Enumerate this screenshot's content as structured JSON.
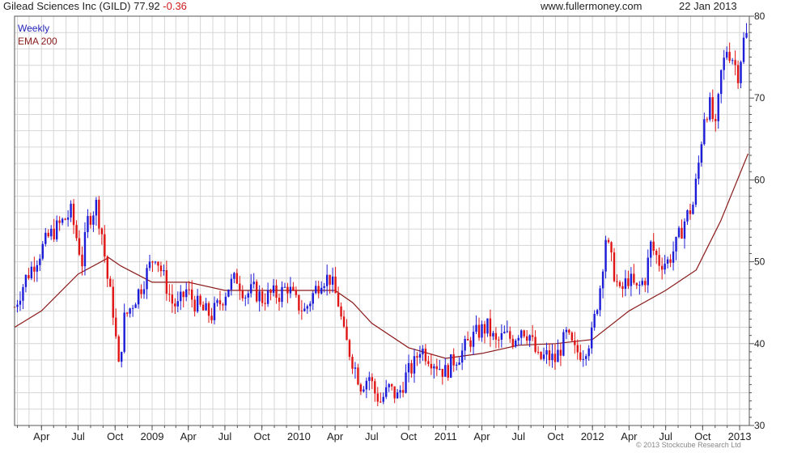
{
  "header": {
    "title": "Gilead Sciences Inc (GILD) 77.92",
    "change": "-0.36",
    "source": "www.fullermoney.com",
    "date": "22 Jan 2013"
  },
  "legend": {
    "weekly": "Weekly",
    "ema": "EMA 200"
  },
  "copyright": "© 2013 Stockcube Research Ltd",
  "colors": {
    "up": "#1c1cd9",
    "down": "#e01414",
    "ema": "#8b1a1a",
    "grid": "#d6d6d6"
  },
  "chart_data": {
    "type": "candlestick",
    "interval": "weekly",
    "y_ticks": [
      30,
      40,
      50,
      60,
      70,
      80
    ],
    "ylim": [
      30,
      80
    ],
    "x_ticks": [
      "Apr",
      "Jul",
      "Oct",
      "2009",
      "Apr",
      "Jul",
      "Oct",
      "2010",
      "Apr",
      "Jul",
      "Oct",
      "2011",
      "Apr",
      "Jul",
      "Oct",
      "2012",
      "Apr",
      "Jul",
      "Oct",
      "2013"
    ],
    "x_tick_dates": [
      "2008-04-01",
      "2008-07-01",
      "2008-10-01",
      "2009-01-01",
      "2009-04-01",
      "2009-07-01",
      "2009-10-01",
      "2010-01-01",
      "2010-04-01",
      "2010-07-01",
      "2010-10-01",
      "2011-01-01",
      "2011-04-01",
      "2011-07-01",
      "2011-10-01",
      "2012-01-01",
      "2012-04-01",
      "2012-07-01",
      "2012-10-01",
      "2013-01-01"
    ],
    "price_path": [
      [
        "2008-01-25",
        44.5
      ],
      [
        "2008-02-22",
        48
      ],
      [
        "2008-03-21",
        50.5
      ],
      [
        "2008-04-18",
        53
      ],
      [
        "2008-05-16",
        54.5
      ],
      [
        "2008-06-13",
        56
      ],
      [
        "2008-06-27",
        53
      ],
      [
        "2008-07-11",
        50
      ],
      [
        "2008-07-25",
        55
      ],
      [
        "2008-08-15",
        57
      ],
      [
        "2008-08-29",
        53.5
      ],
      [
        "2008-09-12",
        48
      ],
      [
        "2008-09-26",
        44
      ],
      [
        "2008-10-10",
        37
      ],
      [
        "2008-10-24",
        43
      ],
      [
        "2008-11-14",
        45
      ],
      [
        "2008-12-05",
        47
      ],
      [
        "2008-12-26",
        49.5
      ],
      [
        "2009-01-09",
        51
      ],
      [
        "2009-01-23",
        49
      ],
      [
        "2009-02-06",
        47
      ],
      [
        "2009-02-20",
        45
      ],
      [
        "2009-03-06",
        44.5
      ],
      [
        "2009-03-27",
        46.5
      ],
      [
        "2009-04-17",
        45
      ],
      [
        "2009-05-08",
        44
      ],
      [
        "2009-05-29",
        43.5
      ],
      [
        "2009-06-19",
        45
      ],
      [
        "2009-07-10",
        47
      ],
      [
        "2009-07-31",
        48
      ],
      [
        "2009-08-21",
        46
      ],
      [
        "2009-09-11",
        46.5
      ],
      [
        "2009-10-02",
        45.5
      ],
      [
        "2009-10-23",
        46
      ],
      [
        "2009-11-13",
        46
      ],
      [
        "2009-12-04",
        47
      ],
      [
        "2009-12-25",
        45
      ],
      [
        "2010-01-15",
        44
      ],
      [
        "2010-02-05",
        46
      ],
      [
        "2010-02-26",
        48
      ],
      [
        "2010-03-19",
        48
      ],
      [
        "2010-04-09",
        45
      ],
      [
        "2010-04-23",
        41
      ],
      [
        "2010-05-14",
        38
      ],
      [
        "2010-06-04",
        35
      ],
      [
        "2010-06-25",
        36
      ],
      [
        "2010-07-09",
        34
      ],
      [
        "2010-07-23",
        33
      ],
      [
        "2010-08-13",
        34.5
      ],
      [
        "2010-09-03",
        33.5
      ],
      [
        "2010-09-24",
        36
      ],
      [
        "2010-10-15",
        37.5
      ],
      [
        "2010-10-29",
        39.5
      ],
      [
        "2010-11-19",
        38.5
      ],
      [
        "2010-12-10",
        37.5
      ],
      [
        "2010-12-31",
        36.5
      ],
      [
        "2011-01-21",
        38
      ],
      [
        "2011-02-11",
        39
      ],
      [
        "2011-03-04",
        40.5
      ],
      [
        "2011-03-25",
        41.5
      ],
      [
        "2011-04-15",
        42
      ],
      [
        "2011-05-06",
        40
      ],
      [
        "2011-05-27",
        41
      ],
      [
        "2011-06-17",
        40.5
      ],
      [
        "2011-07-08",
        42
      ],
      [
        "2011-07-29",
        41
      ],
      [
        "2011-08-19",
        38
      ],
      [
        "2011-09-09",
        38.5
      ],
      [
        "2011-09-30",
        38
      ],
      [
        "2011-10-14",
        39.5
      ],
      [
        "2011-10-28",
        41
      ],
      [
        "2011-11-18",
        39
      ],
      [
        "2011-12-09",
        39
      ],
      [
        "2011-12-30",
        41
      ],
      [
        "2012-01-20",
        47
      ],
      [
        "2012-02-03",
        53
      ],
      [
        "2012-02-17",
        50
      ],
      [
        "2012-03-09",
        46
      ],
      [
        "2012-03-30",
        48
      ],
      [
        "2012-04-20",
        46.5
      ],
      [
        "2012-05-11",
        48
      ],
      [
        "2012-05-25",
        52
      ],
      [
        "2012-06-15",
        50
      ],
      [
        "2012-07-06",
        50
      ],
      [
        "2012-07-27",
        52
      ],
      [
        "2012-08-17",
        55
      ],
      [
        "2012-09-07",
        57
      ],
      [
        "2012-09-21",
        62
      ],
      [
        "2012-10-05",
        68
      ],
      [
        "2012-10-19",
        69
      ],
      [
        "2012-11-02",
        66
      ],
      [
        "2012-11-16",
        73
      ],
      [
        "2012-11-30",
        76
      ],
      [
        "2012-12-14",
        75
      ],
      [
        "2012-12-28",
        73
      ],
      [
        "2013-01-11",
        77
      ],
      [
        "2013-01-22",
        77.92
      ]
    ],
    "ema_200": [
      [
        "2008-01-25",
        42
      ],
      [
        "2008-04-01",
        44
      ],
      [
        "2008-07-01",
        48.5
      ],
      [
        "2008-09-15",
        50.5
      ],
      [
        "2008-10-15",
        49.5
      ],
      [
        "2009-01-01",
        47.5
      ],
      [
        "2009-04-01",
        47.5
      ],
      [
        "2009-07-01",
        46.5
      ],
      [
        "2009-10-01",
        46.5
      ],
      [
        "2010-01-01",
        46.5
      ],
      [
        "2010-04-01",
        46.5
      ],
      [
        "2010-05-15",
        45
      ],
      [
        "2010-07-01",
        42.5
      ],
      [
        "2010-10-01",
        39.5
      ],
      [
        "2011-01-01",
        38.2
      ],
      [
        "2011-04-01",
        38.8
      ],
      [
        "2011-07-01",
        39.8
      ],
      [
        "2011-10-01",
        40
      ],
      [
        "2012-01-01",
        40.5
      ],
      [
        "2012-04-01",
        44
      ],
      [
        "2012-07-01",
        46.5
      ],
      [
        "2012-09-15",
        49
      ],
      [
        "2012-11-15",
        55
      ],
      [
        "2013-01-22",
        63.2
      ]
    ]
  }
}
